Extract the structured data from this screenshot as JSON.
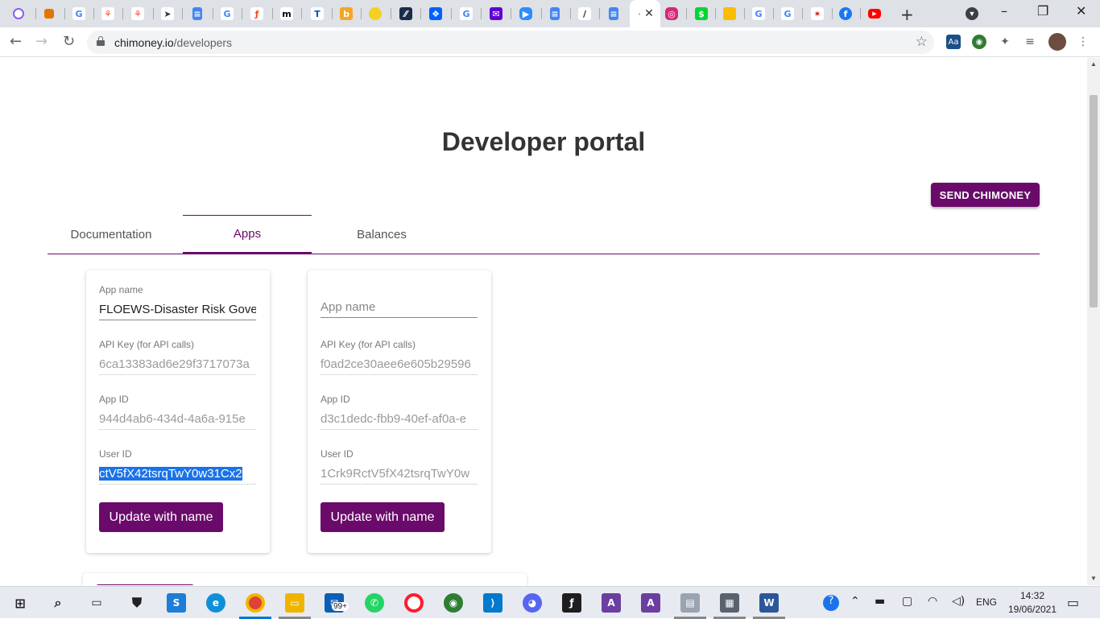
{
  "browser": {
    "address": {
      "domain": "chimoney.io",
      "path": "/developers"
    },
    "tabs_icons": [
      "chimoney-icon",
      "calendar-icon",
      "google-icon",
      "laravel-icon",
      "laravel-icon",
      "send-icon",
      "docs-icon",
      "google-icon",
      "figma-icon",
      "medium-icon",
      "trello-icon",
      "bubble-icon",
      "coin-icon",
      "wave-icon",
      "dropbox-icon",
      "google-icon",
      "mail-icon",
      "zoom-icon",
      "docs-icon",
      "pen-icon",
      "docs-icon",
      "active-tab",
      "instagram-icon",
      "cashapp-icon",
      "keep-icon",
      "google-icon",
      "google-icon",
      "ballet-icon",
      "facebook-icon",
      "youtube-icon"
    ],
    "new_tab": "+",
    "window_controls": {
      "minimize": "–",
      "restore": "❐",
      "close": "✕"
    }
  },
  "page": {
    "title": "Developer portal",
    "send_button": "SEND CHIMONEY",
    "tabs": [
      {
        "label": "Documentation",
        "active": false
      },
      {
        "label": "Apps",
        "active": true
      },
      {
        "label": "Balances",
        "active": false
      }
    ],
    "apps": [
      {
        "app_name_label": "App name",
        "app_name": "FLOEWS-Disaster Risk Governance",
        "api_key_label": "API Key (for API calls)",
        "api_key": "6ca13383ad6e29f3717073a",
        "app_id_label": "App ID",
        "app_id": "944d4ab6-434d-4a6a-915e",
        "user_id_label": "User ID",
        "user_id": "ctV5fX42tsrqTwY0w31Cx2",
        "button": "Update with name"
      },
      {
        "app_name_placeholder": "App name",
        "api_key_label": "API Key (for API calls)",
        "api_key": "f0ad2ce30aee6e605b29596",
        "app_id_label": "App ID",
        "app_id": "d3c1dedc-fbb9-40ef-af0a-e",
        "user_id_label": "User ID",
        "user_id": "1Crk9RctV5fX42tsrqTwY0w",
        "button": "Update with name"
      }
    ]
  },
  "taskbar": {
    "notification_badge": "99+",
    "language": "ENG",
    "time": "14:32",
    "date": "19/06/2021"
  },
  "colors": {
    "brand": "#6a0a6a",
    "selection": "#1a73e8"
  }
}
